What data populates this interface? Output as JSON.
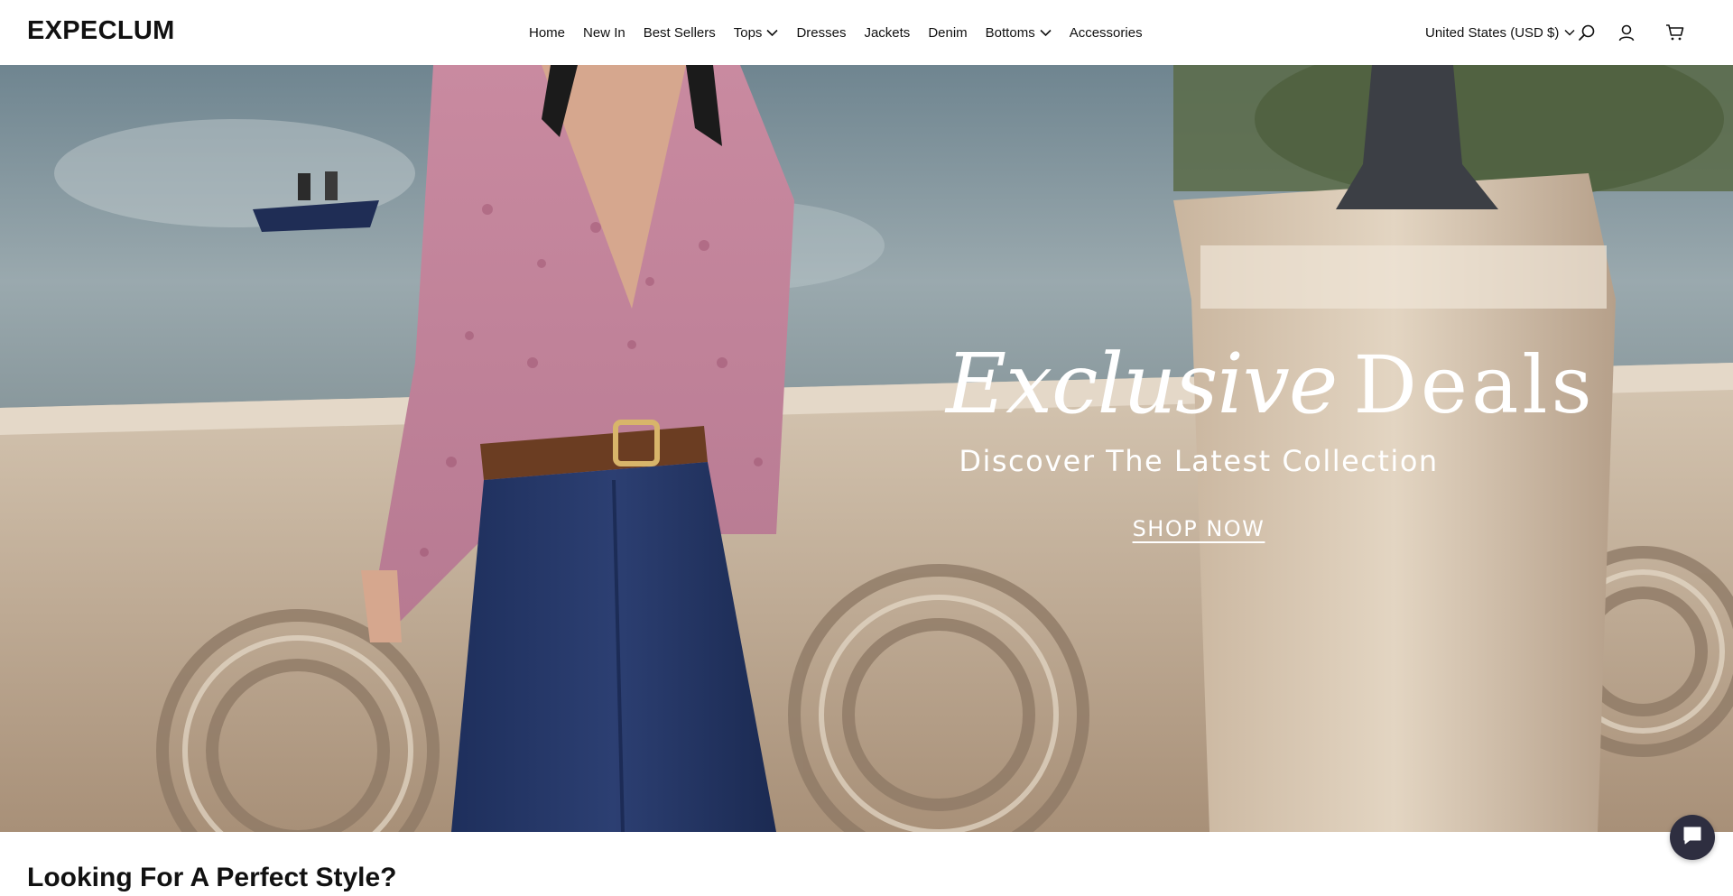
{
  "brand": {
    "logo": "EXPECLUM"
  },
  "nav": {
    "items": [
      {
        "label": "Home",
        "has_dropdown": false
      },
      {
        "label": "New In",
        "has_dropdown": false
      },
      {
        "label": "Best Sellers",
        "has_dropdown": false
      },
      {
        "label": "Tops",
        "has_dropdown": true
      },
      {
        "label": "Dresses",
        "has_dropdown": false
      },
      {
        "label": "Jackets",
        "has_dropdown": false
      },
      {
        "label": "Denim",
        "has_dropdown": false
      },
      {
        "label": "Bottoms",
        "has_dropdown": true
      },
      {
        "label": "Accessories",
        "has_dropdown": false
      }
    ]
  },
  "utility": {
    "currency_label": "United States (USD $)",
    "icons": [
      "search-icon",
      "account-icon",
      "cart-icon"
    ]
  },
  "hero": {
    "title_word_1": "Exclusive",
    "title_word_2": "Deals",
    "subtitle": "Discover The Latest Collection",
    "cta_label": "SHOP NOW"
  },
  "section": {
    "title": "Looking For A Perfect Style?"
  },
  "chat": {
    "icon": "chat-icon"
  },
  "colors": {
    "header_bg": "#ffffff",
    "text": "#111111",
    "hero_text": "#ffffff",
    "chat_bg": "#2e2e40"
  }
}
